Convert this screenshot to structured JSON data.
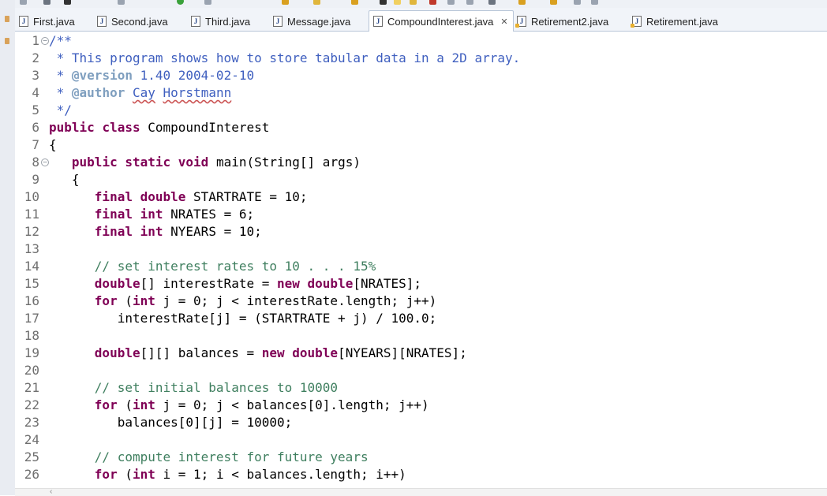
{
  "tabs": [
    {
      "label": "First.java",
      "active": false
    },
    {
      "label": "Second.java",
      "active": false
    },
    {
      "label": "Third.java",
      "active": false
    },
    {
      "label": "Message.java",
      "active": false
    },
    {
      "label": "CompoundInterest.java",
      "active": true
    },
    {
      "label": "Retirement2.java",
      "active": false
    },
    {
      "label": "Retirement.java",
      "active": false
    }
  ],
  "close_glyph": "✕",
  "editor": {
    "line_numbers": [
      "1",
      "2",
      "3",
      "4",
      "5",
      "6",
      "7",
      "8",
      "9",
      "10",
      "11",
      "12",
      "13",
      "14",
      "15",
      "16",
      "17",
      "18",
      "19",
      "20",
      "21",
      "22",
      "23",
      "24",
      "25",
      "26"
    ],
    "lines": [
      [
        {
          "t": "/**",
          "s": "d"
        }
      ],
      [
        {
          "t": " * This program shows how to store tabular data in a 2D array.",
          "s": "d"
        }
      ],
      [
        {
          "t": " * ",
          "s": "d"
        },
        {
          "t": "@version",
          "s": "t"
        },
        {
          "t": " 1.40 2004-02-10",
          "s": "d"
        }
      ],
      [
        {
          "t": " * ",
          "s": "d"
        },
        {
          "t": "@author",
          "s": "t"
        },
        {
          "t": " ",
          "s": "d"
        },
        {
          "t": "Cay",
          "s": "du"
        },
        {
          "t": " ",
          "s": "d"
        },
        {
          "t": "Horstmann",
          "s": "du"
        }
      ],
      [
        {
          "t": " */",
          "s": "d"
        }
      ],
      [
        {
          "t": "public",
          "s": "k"
        },
        {
          "t": " "
        },
        {
          "t": "class",
          "s": "k"
        },
        {
          "t": " CompoundInterest"
        }
      ],
      [
        {
          "t": "{"
        }
      ],
      [
        {
          "t": "   "
        },
        {
          "t": "public",
          "s": "k"
        },
        {
          "t": " "
        },
        {
          "t": "static",
          "s": "k"
        },
        {
          "t": " "
        },
        {
          "t": "void",
          "s": "k"
        },
        {
          "t": " main(String[] args)"
        }
      ],
      [
        {
          "t": "   {"
        }
      ],
      [
        {
          "t": "      "
        },
        {
          "t": "final",
          "s": "k"
        },
        {
          "t": " "
        },
        {
          "t": "double",
          "s": "k"
        },
        {
          "t": " STARTRATE = 10;"
        }
      ],
      [
        {
          "t": "      "
        },
        {
          "t": "final",
          "s": "k"
        },
        {
          "t": " "
        },
        {
          "t": "int",
          "s": "k"
        },
        {
          "t": " NRATES = 6;"
        }
      ],
      [
        {
          "t": "      "
        },
        {
          "t": "final",
          "s": "k"
        },
        {
          "t": " "
        },
        {
          "t": "int",
          "s": "k"
        },
        {
          "t": " NYEARS = 10;"
        }
      ],
      [
        {
          "t": ""
        }
      ],
      [
        {
          "t": "      "
        },
        {
          "t": "// set interest rates to 10 . . . 15%",
          "s": "c"
        }
      ],
      [
        {
          "t": "      "
        },
        {
          "t": "double",
          "s": "k"
        },
        {
          "t": "[] interestRate = "
        },
        {
          "t": "new",
          "s": "k"
        },
        {
          "t": " "
        },
        {
          "t": "double",
          "s": "k"
        },
        {
          "t": "[NRATES];"
        }
      ],
      [
        {
          "t": "      "
        },
        {
          "t": "for",
          "s": "k"
        },
        {
          "t": " ("
        },
        {
          "t": "int",
          "s": "k"
        },
        {
          "t": " j = 0; j < interestRate.length; j++)"
        }
      ],
      [
        {
          "t": "         interestRate[j] = (STARTRATE + j) / 100.0;"
        }
      ],
      [
        {
          "t": ""
        }
      ],
      [
        {
          "t": "      "
        },
        {
          "t": "double",
          "s": "k"
        },
        {
          "t": "[][] balances = "
        },
        {
          "t": "new",
          "s": "k"
        },
        {
          "t": " "
        },
        {
          "t": "double",
          "s": "k"
        },
        {
          "t": "[NYEARS][NRATES];"
        }
      ],
      [
        {
          "t": ""
        }
      ],
      [
        {
          "t": "      "
        },
        {
          "t": "// set initial balances to 10000",
          "s": "c"
        }
      ],
      [
        {
          "t": "      "
        },
        {
          "t": "for",
          "s": "k"
        },
        {
          "t": " ("
        },
        {
          "t": "int",
          "s": "k"
        },
        {
          "t": " j = 0; j < balances[0].length; j++)"
        }
      ],
      [
        {
          "t": "         balances[0][j] = 10000;"
        }
      ],
      [
        {
          "t": ""
        }
      ],
      [
        {
          "t": "      "
        },
        {
          "t": "// compute interest for future years",
          "s": "c"
        }
      ],
      [
        {
          "t": "      "
        },
        {
          "t": "for",
          "s": "k"
        },
        {
          "t": " ("
        },
        {
          "t": "int",
          "s": "k"
        },
        {
          "t": " i = 1; i < balances.length; i++)"
        }
      ]
    ],
    "fold_lines": [
      "1",
      "8"
    ]
  },
  "colors": {
    "keyword": "#7f0055",
    "comment": "#3f7f5f",
    "javadoc": "#3f5fbf",
    "javadoc_tag": "#7f9fbf"
  }
}
